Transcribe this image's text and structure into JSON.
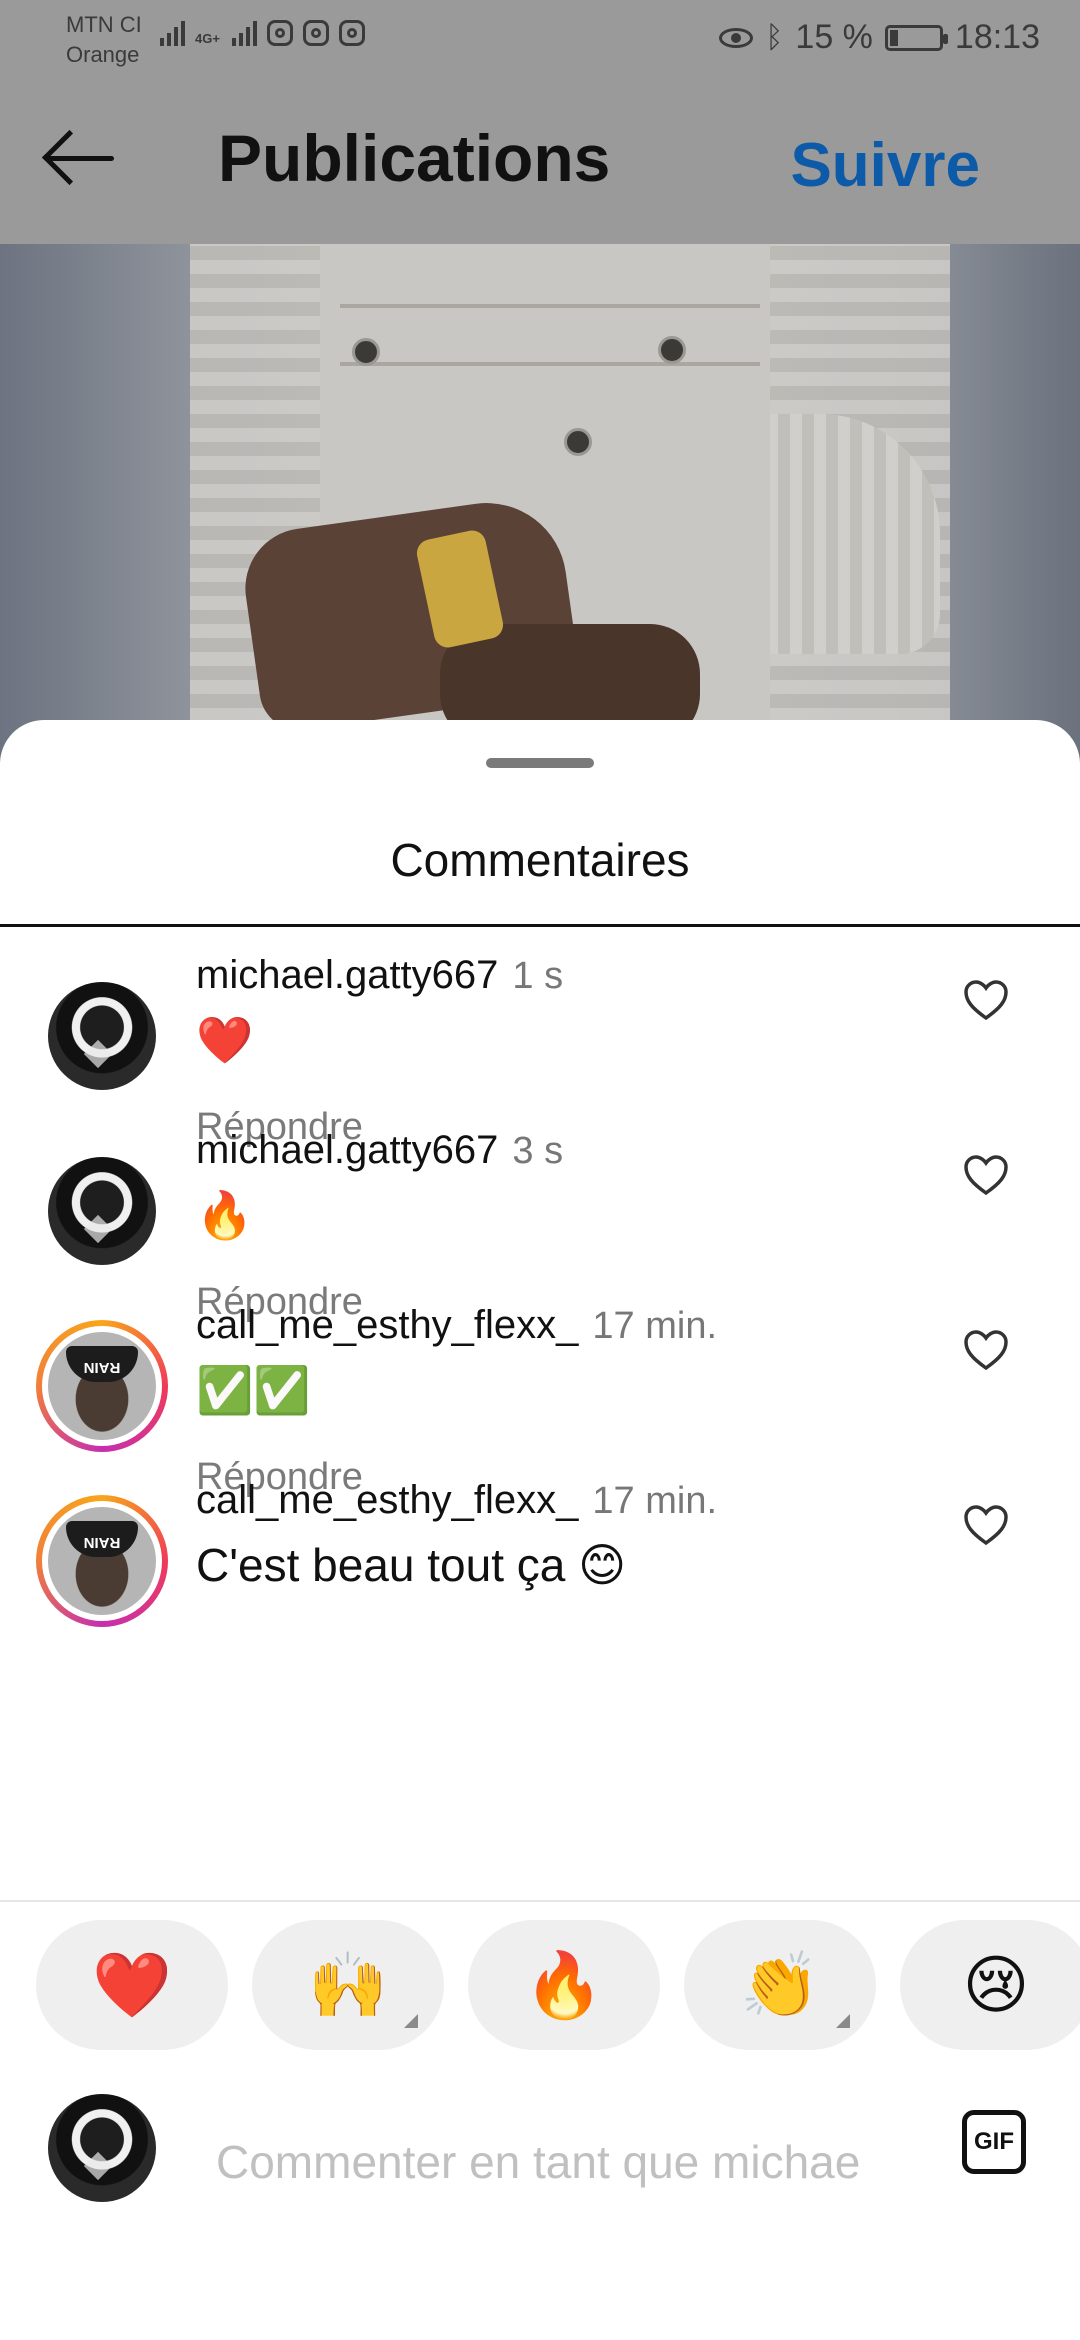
{
  "status_bar": {
    "carrier_line1": "MTN CI",
    "carrier_line2": "Orange",
    "network": "4G+",
    "battery": "15 %",
    "time": "18:13",
    "icons": [
      "signal-icon",
      "signal-4g-icon",
      "instagram-icon",
      "huawei-app-icon",
      "instagram-icon",
      "eye-icon",
      "bluetooth-icon",
      "battery-charging-icon"
    ]
  },
  "header": {
    "title": "Publications",
    "follow_label": "Suivre",
    "back_icon": "arrow-left-icon",
    "follow_color": "#0c5aa8"
  },
  "sheet": {
    "title": "Commentaires"
  },
  "comments": [
    {
      "user": "michael.gatty667",
      "time": "1 s",
      "text": "❤️",
      "reply": "Répondre"
    },
    {
      "user": "michael.gatty667",
      "time": "3 s",
      "text": "🔥",
      "reply": "Répondre"
    },
    {
      "user": "call_me_esthy_flexx_",
      "time": "17 min.",
      "text": "✅✅",
      "reply": "Répondre",
      "avatar_cap_text": "RAIN"
    },
    {
      "user": "call_me_esthy_flexx_",
      "time": "17 min.",
      "text": "C'est beau tout ça 😊",
      "avatar_cap_text": "RAIN"
    }
  ],
  "reactions": [
    {
      "emoji": "❤️",
      "name": "red-heart"
    },
    {
      "emoji": "🙌",
      "name": "raising-hands"
    },
    {
      "emoji": "🔥",
      "name": "fire"
    },
    {
      "emoji": "👏",
      "name": "clapping-hands"
    },
    {
      "emoji": "😢",
      "name": "crying-face"
    }
  ],
  "composer": {
    "placeholder": "Commenter en tant que michae",
    "gif_label": "GIF"
  }
}
